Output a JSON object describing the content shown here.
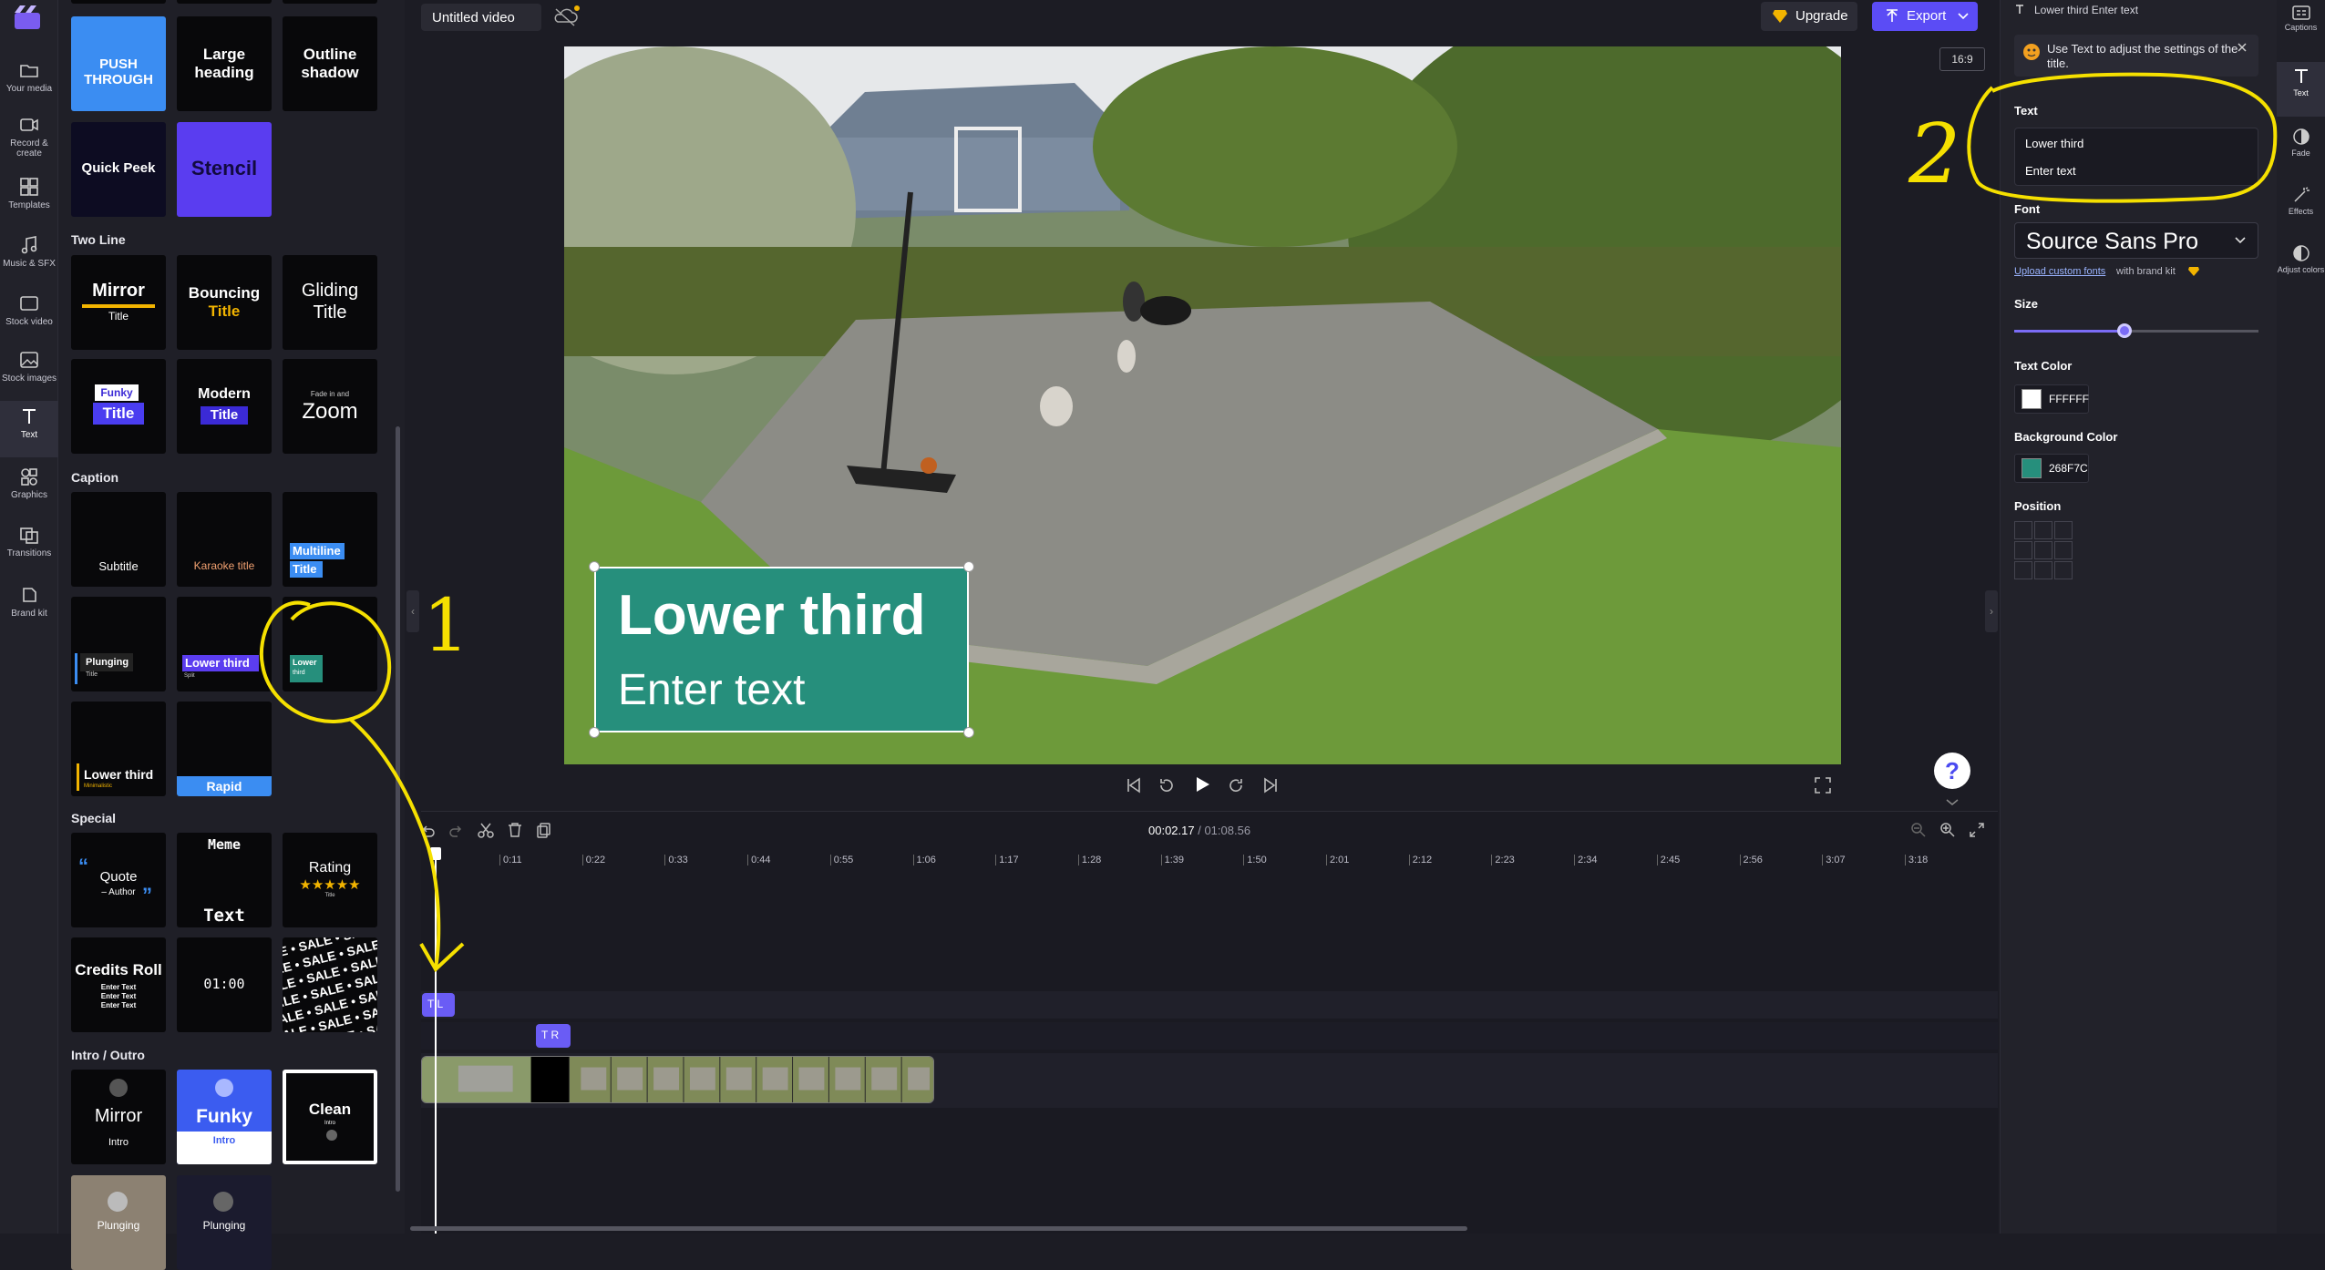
{
  "rail": {
    "items": [
      {
        "label": "Your media",
        "icon": "folder-icon"
      },
      {
        "label": "Record & create",
        "icon": "camera-icon"
      },
      {
        "label": "Templates",
        "icon": "templates-icon"
      },
      {
        "label": "Music & SFX",
        "icon": "music-icon"
      },
      {
        "label": "Stock video",
        "icon": "stock-video-icon"
      },
      {
        "label": "Stock images",
        "icon": "image-icon"
      },
      {
        "label": "Text",
        "icon": "text-icon"
      },
      {
        "label": "Graphics",
        "icon": "graphics-icon"
      },
      {
        "label": "Transitions",
        "icon": "transitions-icon"
      },
      {
        "label": "Brand kit",
        "icon": "brand-kit-icon"
      }
    ]
  },
  "panel": {
    "sections": {
      "two_line": "Two Line",
      "caption": "Caption",
      "special": "Special",
      "intro_outro": "Intro / Outro"
    },
    "tiles": {
      "push_through": "PUSH THROUGH",
      "large_heading": "Large heading",
      "outline_shadow": "Outline shadow",
      "quick_peek": "Quick Peek",
      "stencil": "Stencil",
      "mirror": "Mirror",
      "mirror_sub": "Title",
      "bouncing": "Bouncing",
      "bouncing_sub": "Title",
      "gliding": "Gliding",
      "gliding_sub": "Title",
      "funky": "Funky",
      "funky_sub": "Title",
      "modern": "Modern",
      "modern_sub": "Title",
      "fade_in_out": "Fade in and",
      "zoom": "Zoom",
      "subtitle": "Subtitle",
      "karaoke": "Karaoke title",
      "multiline_1": "Multiline",
      "multiline_2": "Title",
      "plunging": "Plunging",
      "plunging_sub": "Title",
      "lower_third": "Lower third",
      "lower_third_sub": "Split",
      "lower_small_1": "Lower",
      "lower_small_2": "third",
      "lower_third_min": "Lower third",
      "lower_third_min_sub": "Minimalistic",
      "rapid": "Rapid",
      "quote": "Quote",
      "quote_author": "– Author",
      "meme_top": "Meme",
      "meme_bottom": "Text",
      "rating": "Rating",
      "rating_stars": "★★★★★",
      "rating_sub": "Title",
      "credits": "Credits Roll",
      "credits_l1": "Enter Text",
      "credits_l2": "Enter Text",
      "credits_l3": "Enter Text",
      "timer": "01:00",
      "sale": "SALE • SALE • SALE • SALE",
      "intro_mirror": "Mirror",
      "intro_mirror_sub": "Intro",
      "intro_funky": "Funky",
      "intro_funky_sub": "Intro",
      "intro_clean": "Clean",
      "intro_clean_sub": "Intro",
      "intro_plunging_1": "Plunging",
      "intro_plunging_2": "Plunging"
    }
  },
  "topbar": {
    "title": "Untitled video",
    "upgrade": "Upgrade",
    "export": "Export",
    "ratio": "16:9"
  },
  "preview": {
    "lower_third_title": "Lower third",
    "lower_third_sub": "Enter text"
  },
  "help": "?",
  "timeline": {
    "current_time": "00:02.17",
    "total_time": " / 01:08.56",
    "ruler": [
      "0:11",
      "0:22",
      "0:33",
      "0:44",
      "0:55",
      "1:06",
      "1:17",
      "1:28",
      "1:39",
      "1:50",
      "2:01",
      "2:12",
      "2:23",
      "2:34",
      "2:45",
      "2:56",
      "3:07",
      "3:18"
    ],
    "clip1_label": "T L",
    "clip2_label": "T R"
  },
  "props": {
    "header": "Lower third Enter text",
    "tip": "Use Text to adjust the settings of the title.",
    "text_label": "Text",
    "text_line1": "Lower third",
    "text_line2": "Enter text",
    "font_label": "Font",
    "font_value": "Source Sans Pro",
    "upload_link": "Upload custom fonts",
    "upload_rest": "with brand kit",
    "size_label": "Size",
    "size_value": 0.45,
    "text_color_label": "Text Color",
    "text_color_hex": "FFFFFF",
    "text_color": "#FFFFFF",
    "bg_color_label": "Background Color",
    "bg_color_hex": "268F7C",
    "bg_color": "#268F7C",
    "position_label": "Position"
  },
  "right_rail": {
    "items": [
      {
        "label": "Captions",
        "icon": "captions-icon"
      },
      {
        "label": "Text",
        "icon": "text-icon"
      },
      {
        "label": "Fade",
        "icon": "fade-icon"
      },
      {
        "label": "Effects",
        "icon": "effects-icon"
      },
      {
        "label": "Adjust colors",
        "icon": "adjust-colors-icon"
      }
    ]
  },
  "annotations": {
    "mark_1": "1",
    "mark_2": "2"
  }
}
